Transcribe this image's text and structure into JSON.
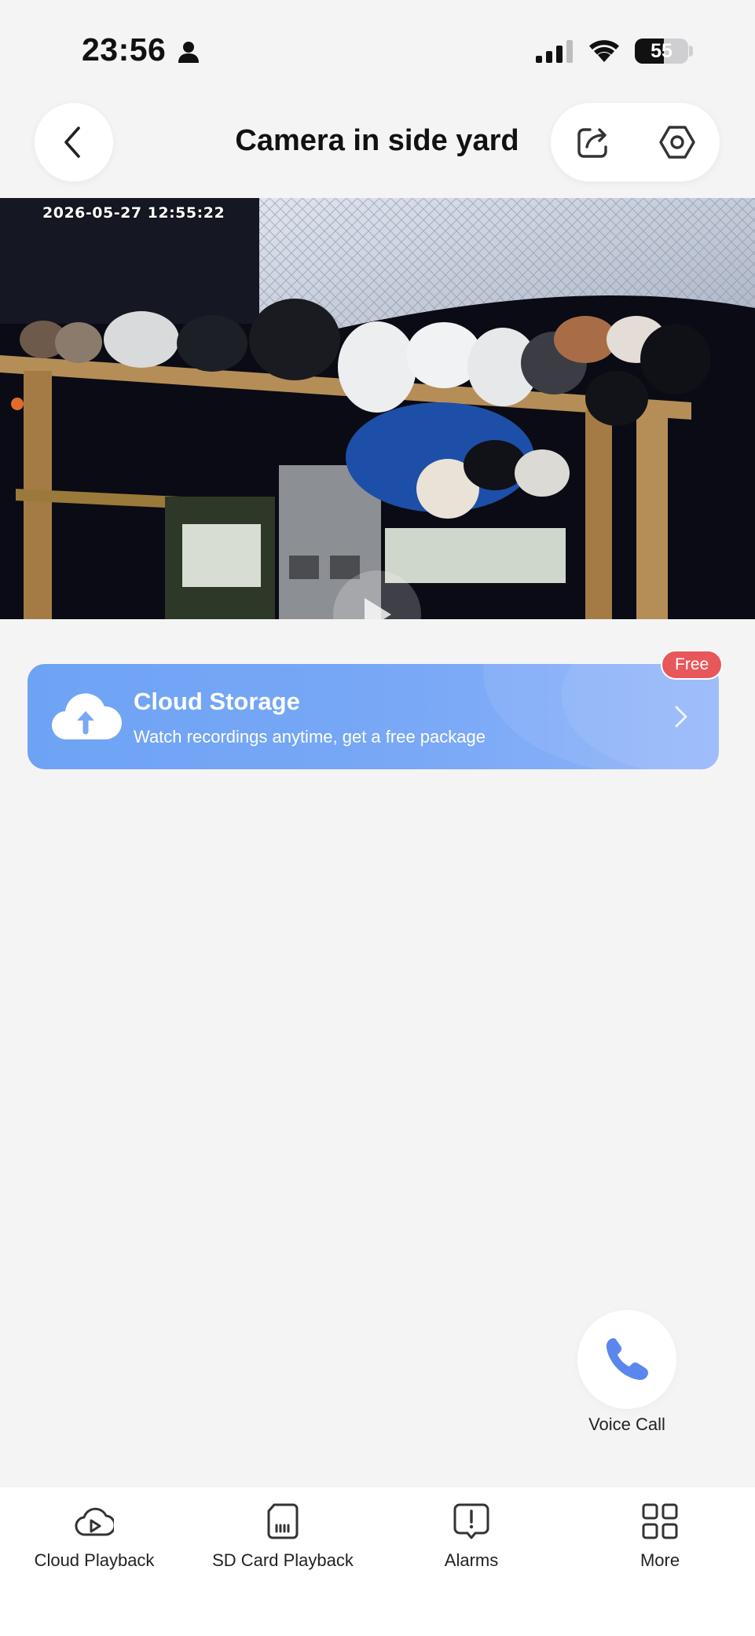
{
  "status_bar": {
    "time": "23:56",
    "battery": "55",
    "battery_level_percent": 55
  },
  "header": {
    "title": "Camera in side yard",
    "back_icon": "chevron-left-icon",
    "share_icon": "share-icon",
    "settings_icon": "hexagon-settings-icon"
  },
  "video": {
    "timestamp": "2026-05-27  12:55:22",
    "play_icon": "play-icon"
  },
  "cloud_banner": {
    "title": "Cloud Storage",
    "subtitle": "Watch recordings anytime, get a free package",
    "badge": "Free",
    "icon": "cloud-upload-icon"
  },
  "voice_call": {
    "label": "Voice Call",
    "icon": "phone-icon"
  },
  "bottom_nav": {
    "items": [
      {
        "label": "Cloud Playback",
        "icon": "cloud-play-icon"
      },
      {
        "label": "SD Card Playback",
        "icon": "sd-card-icon"
      },
      {
        "label": "Alarms",
        "icon": "alarm-alert-icon"
      },
      {
        "label": "More",
        "icon": "grid-icon"
      }
    ]
  },
  "colors": {
    "accent_blue": "#6ea3f4",
    "badge_red": "#e8575a",
    "phone_blue": "#5b86ee",
    "background": "#f4f4f5"
  }
}
